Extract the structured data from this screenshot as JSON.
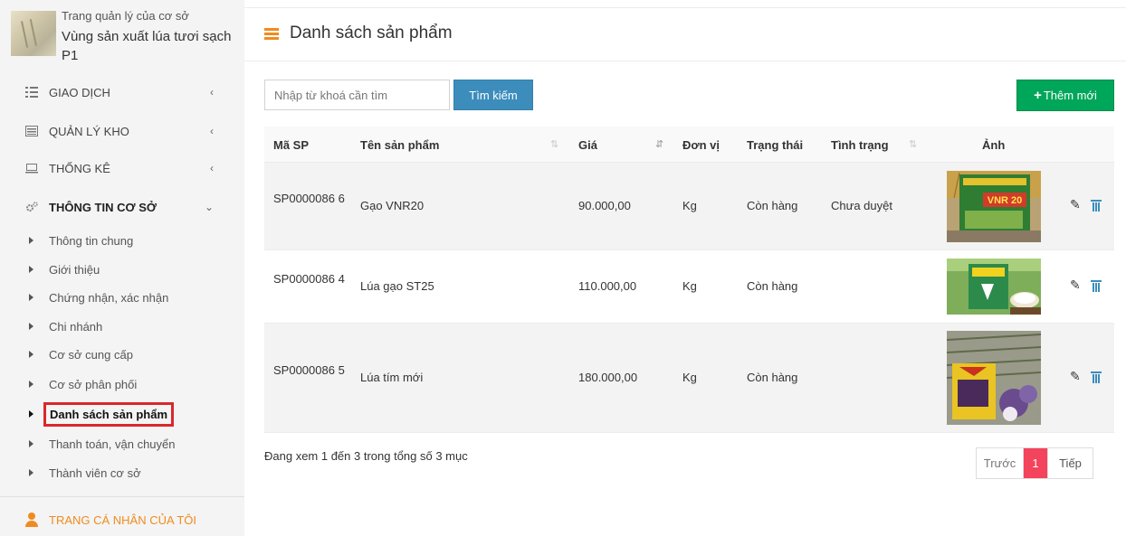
{
  "sidebar": {
    "brand_subtitle": "Trang quản lý của cơ sở",
    "brand_title": "Vùng sản xuất lúa tươi sạch P1",
    "menu": [
      {
        "label": "GIAO DỊCH",
        "icon": "grid-icon",
        "chevron": "‹"
      },
      {
        "label": "QUẢN LÝ KHO",
        "icon": "list-icon",
        "chevron": "‹"
      },
      {
        "label": "THỐNG KÊ",
        "icon": "monitor-icon",
        "chevron": "‹"
      },
      {
        "label": "THÔNG TIN CƠ SỞ",
        "icon": "gears-icon",
        "chevron": "⌄"
      }
    ],
    "submenu": [
      "Thông tin chung",
      "Giới thiệu",
      "Chứng nhận, xác nhận",
      "Chi nhánh",
      "Cơ sở cung cấp",
      "Cơ sở phân phối",
      "Danh sách sản phẩm",
      "Thanh toán, vận chuyển",
      "Thành viên cơ sở"
    ],
    "active_submenu": "Danh sách sản phẩm",
    "profile_label": "TRANG CÁ NHÂN CỦA TÔI"
  },
  "header": {
    "title": "Danh sách sản phẩm"
  },
  "toolbar": {
    "search_placeholder": "Nhập từ khoá cần tìm",
    "search_button": "Tìm kiếm",
    "add_button": "Thêm mới",
    "add_icon": "+"
  },
  "table": {
    "columns": [
      "Mã SP",
      "Tên sản phẩm",
      "Giá",
      "Đơn vị",
      "Trạng thái",
      "Tình trạng",
      "Ảnh"
    ],
    "rows": [
      {
        "code": "SP0000086 6",
        "name": "Gạo VNR20",
        "price": "90.000,00",
        "unit": "Kg",
        "status": "Còn hàng",
        "condition": "Chưa duyệt",
        "image_text": "VNR 20",
        "image": "rice-bag-vnr20"
      },
      {
        "code": "SP0000086 4",
        "name": "Lúa gạo ST25",
        "price": "110.000,00",
        "unit": "Kg",
        "status": "Còn hàng",
        "condition": "",
        "image": "rice-bag-st25"
      },
      {
        "code": "SP0000086 5",
        "name": "Lúa tím mới",
        "price": "180.000,00",
        "unit": "Kg",
        "status": "Còn hàng",
        "condition": "",
        "image": "purple-rice"
      }
    ]
  },
  "footer": {
    "info": "Đang xem 1 đến 3 trong tổng số 3 mục",
    "prev": "Trước",
    "current": "1",
    "next": "Tiếp"
  },
  "colors": {
    "accent_orange": "#f08b1f",
    "primary_blue": "#3c8dbc",
    "success_green": "#00a65a",
    "page_active": "#f4435c",
    "highlight_red": "#d9282b"
  }
}
